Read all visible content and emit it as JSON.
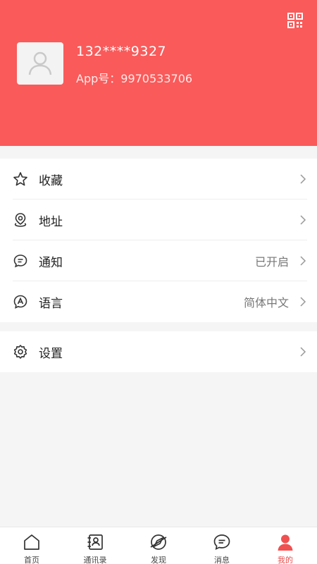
{
  "profile": {
    "phone": "132****9327",
    "app_id": "App号：9970533706"
  },
  "menu": {
    "favorites": {
      "label": "收藏",
      "icon": "star-icon"
    },
    "address": {
      "label": "地址",
      "icon": "location-pin-icon"
    },
    "notifications": {
      "label": "通知",
      "value": "已开启",
      "icon": "chat-bubble-icon"
    },
    "language": {
      "label": "语言",
      "value": "简体中文",
      "icon": "language-icon"
    },
    "settings": {
      "label": "设置",
      "icon": "gear-icon"
    }
  },
  "tabs": [
    {
      "label": "首页",
      "icon": "home-icon"
    },
    {
      "label": "通讯录",
      "icon": "contacts-icon"
    },
    {
      "label": "发现",
      "icon": "discover-icon"
    },
    {
      "label": "消息",
      "icon": "message-icon"
    },
    {
      "label": "我的",
      "icon": "user-icon",
      "active": true
    }
  ],
  "colors": {
    "header_bg": "#fa5a5a",
    "accent": "#e84b4b",
    "page_bg": "#f5f5f5"
  }
}
